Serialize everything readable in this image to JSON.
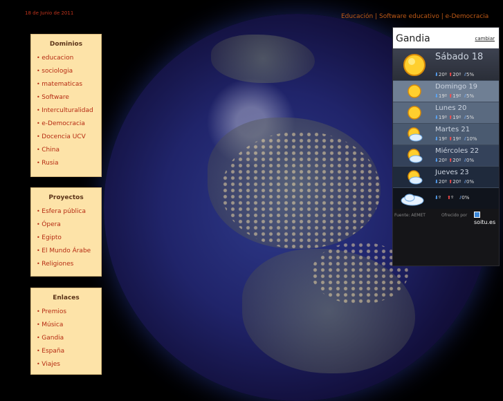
{
  "date": "18 de Junio de 2011",
  "topnav": [
    "Educación",
    "Software educativo",
    "e-Democracia"
  ],
  "menus": [
    {
      "title": "Dominios",
      "items": [
        "educacion",
        "sociologia",
        "matematicas",
        "Software",
        "Interculturalidad",
        "e-Democracia",
        "Docencia UCV",
        "China",
        "Rusia"
      ]
    },
    {
      "title": "Proyectos",
      "items": [
        "Esfera pública",
        "Ópera",
        "Egipto",
        "El Mundo Árabe",
        "Religiones"
      ]
    },
    {
      "title": "Enlaces",
      "items": [
        "Premios",
        "Música",
        "Gandia",
        "España",
        "Viajes"
      ]
    }
  ],
  "weather": {
    "city": "Gandia",
    "change_label": "cambiar",
    "days": [
      {
        "day": "Sábado 18",
        "min": "20º",
        "max": "20º",
        "rain": "5%",
        "icon": "sun-icon"
      },
      {
        "day": "Domingo 19",
        "min": "19º",
        "max": "19º",
        "rain": "5%",
        "icon": "sun-icon"
      },
      {
        "day": "Lunes 20",
        "min": "19º",
        "max": "19º",
        "rain": "5%",
        "icon": "sun-icon"
      },
      {
        "day": "Martes 21",
        "min": "19º",
        "max": "19º",
        "rain": "10%",
        "icon": "sun-cloud-icon"
      },
      {
        "day": "Miércoles 22",
        "min": "20º",
        "max": "20º",
        "rain": "0%",
        "icon": "sun-cloud-icon"
      },
      {
        "day": "Jueves 23",
        "min": "20º",
        "max": "20º",
        "rain": "0%",
        "icon": "sun-cloud-icon"
      },
      {
        "day": "",
        "min": "º",
        "max": "º",
        "rain": "0%",
        "icon": "cloud-icon"
      }
    ],
    "source": "Fuente: AEMET",
    "offered_by": "Ofrecido por",
    "brand": "soitu.es"
  }
}
